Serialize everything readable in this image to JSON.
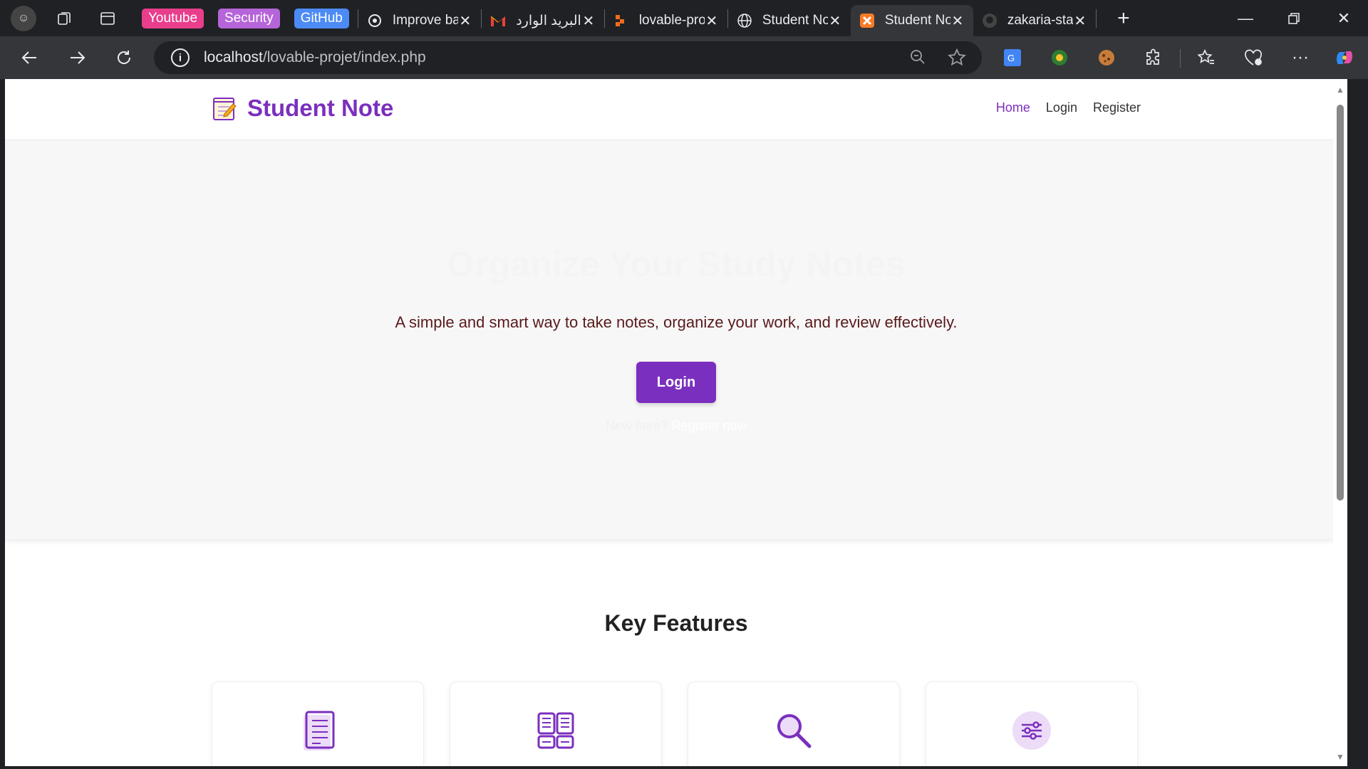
{
  "browser": {
    "bookmarks": [
      {
        "label": "Youtube",
        "color": "#e83e8c"
      },
      {
        "label": "Security",
        "color": "#b565d9"
      },
      {
        "label": "GitHub",
        "color": "#4c8bf5"
      }
    ],
    "tabs": [
      {
        "title": "Improve ba",
        "icon": "openai-icon"
      },
      {
        "title": "البريد الوارد",
        "icon": "gmail-icon"
      },
      {
        "title": "lovable-pro",
        "icon": "lovable-icon"
      },
      {
        "title": "Student No",
        "icon": "globe-icon"
      },
      {
        "title": "Student No",
        "icon": "xampp-icon",
        "active": true
      },
      {
        "title": "zakaria-stac",
        "icon": "github-icon"
      }
    ],
    "url_host": "localhost",
    "url_path": "/lovable-projet/index.php"
  },
  "site": {
    "logo_text": "Student Note",
    "nav": {
      "home": "Home",
      "login": "Login",
      "register": "Register"
    },
    "brand_color": "#7b2fbe"
  },
  "hero": {
    "title": "Organize Your Study Notes",
    "subtitle": "A simple and smart way to take notes, organize your work, and review effectively.",
    "cta": "Login",
    "new_here": "New here?",
    "register_link": "Register now"
  },
  "features": {
    "title": "Key Features",
    "icons": [
      "document-icon",
      "grid-layout-icon",
      "search-icon",
      "sliders-icon"
    ]
  }
}
